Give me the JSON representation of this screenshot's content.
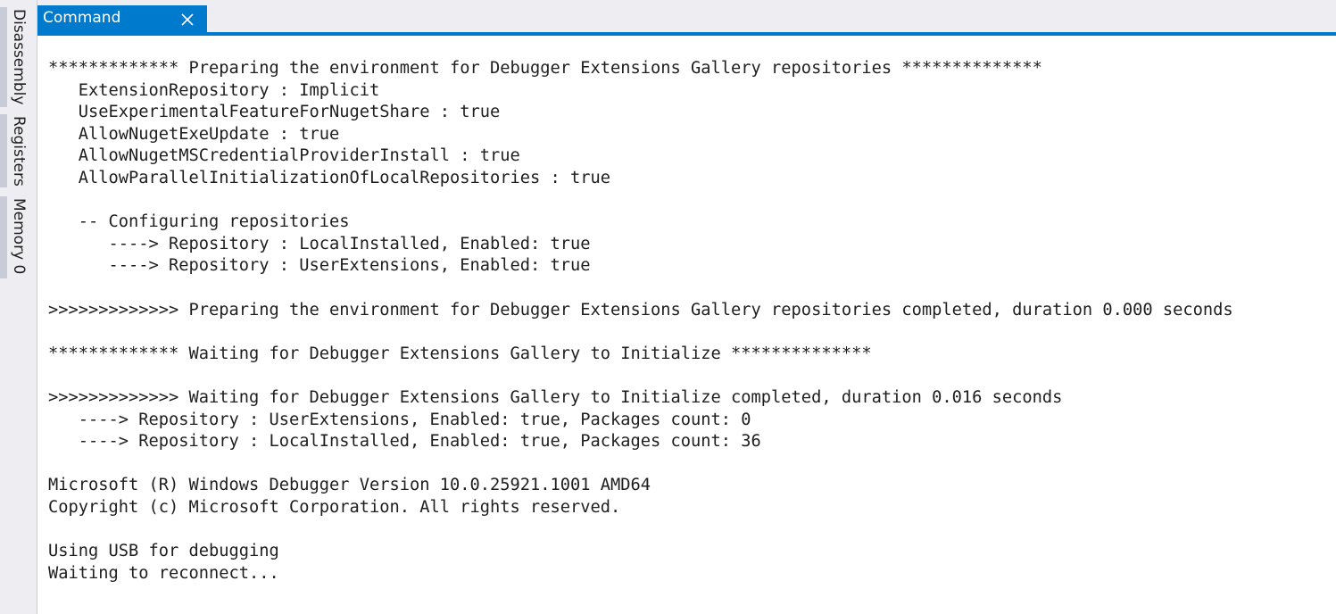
{
  "side_tabs": [
    {
      "label": "Disassembly"
    },
    {
      "label": "Registers"
    },
    {
      "label": "Memory 0"
    }
  ],
  "tab": {
    "title": "Command",
    "close_icon": "close-icon"
  },
  "console": {
    "lines": [
      "************* Preparing the environment for Debugger Extensions Gallery repositories **************",
      "   ExtensionRepository : Implicit",
      "   UseExperimentalFeatureForNugetShare : true",
      "   AllowNugetExeUpdate : true",
      "   AllowNugetMSCredentialProviderInstall : true",
      "   AllowParallelInitializationOfLocalRepositories : true",
      "",
      "   -- Configuring repositories",
      "      ----> Repository : LocalInstalled, Enabled: true",
      "      ----> Repository : UserExtensions, Enabled: true",
      "",
      ">>>>>>>>>>>>> Preparing the environment for Debugger Extensions Gallery repositories completed, duration 0.000 seconds",
      "",
      "************* Waiting for Debugger Extensions Gallery to Initialize **************",
      "",
      ">>>>>>>>>>>>> Waiting for Debugger Extensions Gallery to Initialize completed, duration 0.016 seconds",
      "   ----> Repository : UserExtensions, Enabled: true, Packages count: 0",
      "   ----> Repository : LocalInstalled, Enabled: true, Packages count: 36",
      "",
      "Microsoft (R) Windows Debugger Version 10.0.25921.1001 AMD64",
      "Copyright (c) Microsoft Corporation. All rights reserved.",
      "",
      "Using USB for debugging",
      "Waiting to reconnect..."
    ]
  },
  "colors": {
    "accent": "#007acc",
    "chrome": "#eeeef2",
    "text": "#1e1e1e"
  }
}
